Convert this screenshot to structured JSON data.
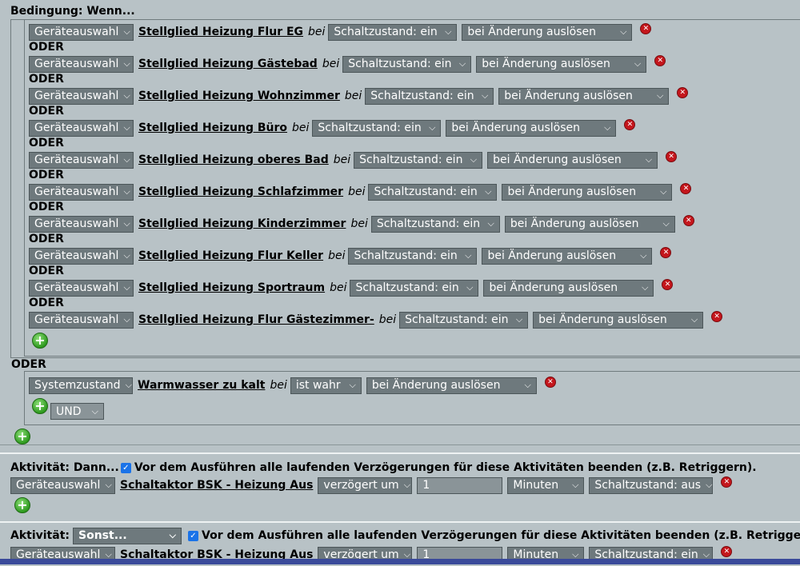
{
  "bedingung": {
    "heading": "Bedingung: Wenn...",
    "oder": "ODER",
    "rows": [
      {
        "type": "Geräteauswahl",
        "device": "Stellglied Heizung Flur EG",
        "bei": "bei",
        "state": "Schaltzustand: ein",
        "trigger": "bei Änderung auslösen"
      },
      {
        "type": "Geräteauswahl",
        "device": "Stellglied Heizung Gästebad",
        "bei": "bei",
        "state": "Schaltzustand: ein",
        "trigger": "bei Änderung auslösen"
      },
      {
        "type": "Geräteauswahl",
        "device": "Stellglied Heizung Wohnzimmer",
        "bei": "bei",
        "state": "Schaltzustand: ein",
        "trigger": "bei Änderung auslösen"
      },
      {
        "type": "Geräteauswahl",
        "device": "Stellglied Heizung Büro",
        "bei": "bei",
        "state": "Schaltzustand: ein",
        "trigger": "bei Änderung auslösen"
      },
      {
        "type": "Geräteauswahl",
        "device": "Stellglied Heizung oberes Bad",
        "bei": "bei",
        "state": "Schaltzustand: ein",
        "trigger": "bei Änderung auslösen"
      },
      {
        "type": "Geräteauswahl",
        "device": "Stellglied Heizung Schlafzimmer",
        "bei": "bei",
        "state": "Schaltzustand: ein",
        "trigger": "bei Änderung auslösen"
      },
      {
        "type": "Geräteauswahl",
        "device": "Stellglied Heizung Kinderzimmer",
        "bei": "bei",
        "state": "Schaltzustand: ein",
        "trigger": "bei Änderung auslösen"
      },
      {
        "type": "Geräteauswahl",
        "device": "Stellglied Heizung Flur Keller",
        "bei": "bei",
        "state": "Schaltzustand: ein",
        "trigger": "bei Änderung auslösen"
      },
      {
        "type": "Geräteauswahl",
        "device": "Stellglied Heizung Sportraum",
        "bei": "bei",
        "state": "Schaltzustand: ein",
        "trigger": "bei Änderung auslösen"
      },
      {
        "type": "Geräteauswahl",
        "device": "Stellglied Heizung Flur Gästezimmer-",
        "bei": "bei",
        "state": "Schaltzustand: ein",
        "trigger": "bei Änderung auslösen"
      }
    ],
    "system": {
      "type": "Systemzustand",
      "device": "Warmwasser zu kalt",
      "bei": "bei",
      "state": "ist wahr",
      "trigger": "bei Änderung auslösen",
      "logic": "UND"
    }
  },
  "dann": {
    "heading": "Aktivität: Dann...",
    "checkbox_label": "Vor dem Ausführen alle laufenden Verzögerungen für diese Aktivitäten beenden (z.B. Retriggern).",
    "type": "Geräteauswahl",
    "device": "Schaltaktor BSK - Heizung Aus",
    "delay": "verzögert um",
    "delay_value": "1",
    "unit": "Minuten",
    "state": "Schaltzustand: aus"
  },
  "sonst": {
    "heading": "Aktivität:",
    "mode": "Sonst...",
    "checkbox_label": "Vor dem Ausführen alle laufenden Verzögerungen für diese Aktivitäten beenden (z.B. Retriggern).",
    "type": "Geräteauswahl",
    "device": "Schaltaktor BSK - Heizung Aus",
    "delay": "verzögert um",
    "delay_value": "1",
    "unit": "Minuten",
    "state": "Schaltzustand: ein"
  },
  "icons": {
    "delete": "delete-icon",
    "add": "add-icon",
    "chevron": "chevron-down-icon",
    "checkbox": "checkbox-checked-icon"
  }
}
